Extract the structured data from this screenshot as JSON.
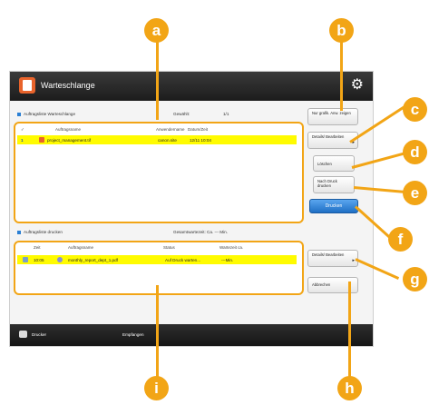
{
  "window": {
    "title": "Warteschlange",
    "settings_icon": "gear-icon"
  },
  "queue_section": {
    "heading": "Auftragsliste Warteschlange",
    "selected_label": "Gewählt:",
    "selected_value": "1/1",
    "columns": [
      "Auftragsname",
      "Anwendername",
      "Datum/Zeit"
    ],
    "rows": [
      {
        "index": "1",
        "name": "project_management.tif",
        "user": "canon.site",
        "datetime": "12/11 10:04",
        "selected": true
      }
    ]
  },
  "print_section": {
    "heading": "Auftragsliste drucken",
    "total_wait_label": "Gesamtwartezeit: Ca. --- Min.",
    "columns": [
      "Zeit",
      "Auftragsname",
      "Status",
      "Wartezeit ca."
    ],
    "rows": [
      {
        "time": "10:05",
        "name": "monthly_report_dept_1.pdf",
        "status": "Auf Druck warten...",
        "wait": "---Min."
      }
    ]
  },
  "buttons": {
    "show_image": "Nur grafik. Anw. zeigen",
    "details_edit_top": "Details/ Bearbeiten",
    "delete": "Löschen",
    "print_after": "Nach Druck drucken",
    "print": "Drucken",
    "details_edit_bottom": "Details/ Bearbeiten",
    "cancel": "Abbrechen"
  },
  "status_bar": {
    "printer_label": "Drucker",
    "reception_label": "Empfangen"
  },
  "callouts": [
    "a",
    "b",
    "c",
    "d",
    "e",
    "f",
    "g",
    "h",
    "i"
  ],
  "colors": {
    "callout": "#f2a516",
    "highlight_row": "#fffb00",
    "print_button": "#2a7fd4",
    "titlebar": "#222222"
  }
}
